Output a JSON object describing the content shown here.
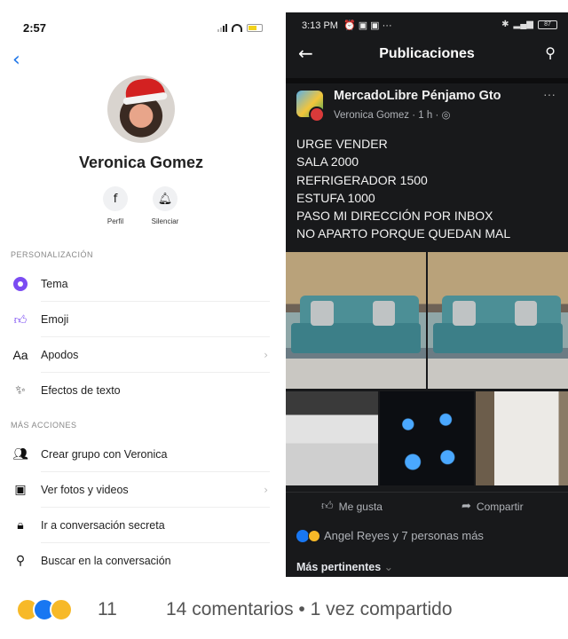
{
  "left": {
    "status_time": "2:57",
    "name": "Veronica Gomez",
    "quick_actions": [
      {
        "label": "Perfil",
        "icon": "facebook-icon"
      },
      {
        "label": "Silenciar",
        "icon": "bell-icon"
      }
    ],
    "sections": {
      "personalization": "PERSONALIZACIÓN",
      "more_actions": "MÁS ACCIONES"
    },
    "personalization_items": [
      {
        "label": "Tema",
        "icon": "theme-dot-icon"
      },
      {
        "label": "Emoji",
        "icon": "thumbs-up-icon"
      },
      {
        "label": "Apodos",
        "icon": "text-aa-icon",
        "glyph": "Aa"
      },
      {
        "label": "Efectos de texto",
        "icon": "magic-wand-icon"
      }
    ],
    "more_items": [
      {
        "label": "Crear grupo con Veronica",
        "icon": "group-icon"
      },
      {
        "label": "Ver fotos y videos",
        "icon": "photos-icon"
      },
      {
        "label": "Ir a conversación secreta",
        "icon": "lock-icon"
      },
      {
        "label": "Buscar en la conversación",
        "icon": "search-icon"
      }
    ]
  },
  "right": {
    "status_time": "3:13 PM",
    "battery": "87",
    "title": "Publicaciones",
    "post": {
      "group": "MercadoLibre Pénjamo Gto",
      "author": "Veronica Gomez",
      "time": "1 h",
      "lines": [
        "URGE VENDER",
        "SALA 2000",
        "REFRIGERADOR 1500",
        "ESTUFA 1000",
        "PASO MI DIRECCIÓN POR INBOX",
        "NO APARTO PORQUE QUEDAN MAL"
      ],
      "like_label": "Me gusta",
      "share_label": "Compartir",
      "reactions_text": "Angel Reyes y 7 personas más",
      "sort_label": "Más pertinentes"
    }
  },
  "bottom": {
    "reaction_count": "11",
    "comments_text": "14 comentarios • 1 vez compartido"
  },
  "colors": {
    "messenger_blue": "#1a73e8",
    "theme_purple": "#7b4cf2",
    "fb_dark": "#18191b",
    "like_blue": "#1877f2"
  }
}
